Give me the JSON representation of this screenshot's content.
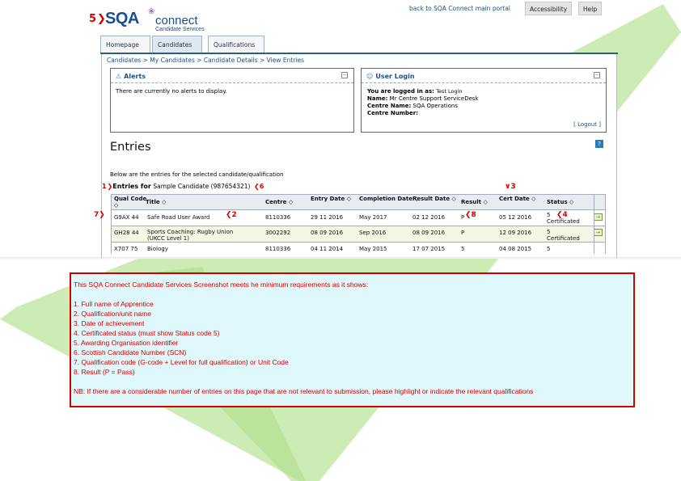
{
  "header": {
    "logo": {
      "brand": "SQA",
      "product": "connect",
      "subtitle": "Candidate Services"
    },
    "back_link": "back to SQA Connect main portal",
    "accessibility_label": "Accessibility",
    "help_label": "Help"
  },
  "tabs": [
    {
      "label": "Homepage"
    },
    {
      "label": "Candidates",
      "active": true
    },
    {
      "label": "Qualifications"
    }
  ],
  "breadcrumb": "Candidates > My Candidates > Candidate Details > View Entries",
  "alerts": {
    "title": "Alerts",
    "message": "There are currently no alerts to display."
  },
  "user_login": {
    "title": "User Login",
    "logged_in_label": "You are logged in as:",
    "logged_in_value": "Test Login",
    "name_label": "Name:",
    "name_value": "Mr Centre Support ServiceDesk",
    "centre_name_label": "Centre Name:",
    "centre_name_value": "SQA Operations",
    "centre_number_label": "Centre Number:",
    "logout_label": "[ Logout ]"
  },
  "entries": {
    "title": "Entries",
    "description": "Below are the entries for the selected candidate/qualification",
    "for_label": "Entries for",
    "candidate": "Sample Candidate (987654321)",
    "columns": [
      "Qual Code",
      "Title",
      "Centre",
      "Entry Date",
      "Completion Date",
      "Result Date",
      "Result",
      "Cert Date",
      "Status"
    ],
    "rows": [
      {
        "qual_code": "G9AX 44",
        "title": "Safe Road User Award",
        "title2": "",
        "centre": "8110336",
        "entry_date": "29 11 2016",
        "completion_date": "May 2017",
        "result_date": "02 12 2016",
        "result": "P",
        "cert_date": "05 12 2016",
        "status": "5",
        "status2": "Certificated"
      },
      {
        "qual_code": "GH28 44",
        "title": "Sports Coaching: Rugby Union",
        "title2": "(UKCC Level 1)",
        "centre": "3002292",
        "entry_date": "08 09 2016",
        "completion_date": "Sep 2016",
        "result_date": "08 09 2016",
        "result": "P",
        "cert_date": "12 09 2016",
        "status": "5",
        "status2": "Certificated"
      },
      {
        "qual_code": "X707 75",
        "title": "Biology",
        "title2": "",
        "centre": "8110336",
        "entry_date": "04 11 2014",
        "completion_date": "May 2015",
        "result_date": "17 07 2015",
        "result": "5",
        "cert_date": "04 08 2015",
        "status": "5",
        "status2": ""
      }
    ]
  },
  "annotations": {
    "n1": "1",
    "n2": "2",
    "n3": "3",
    "n4": "4",
    "n5": "5",
    "n6": "6",
    "n7": "7",
    "n8": "8"
  },
  "requirements": {
    "intro": "This SQA Connect Candidate Services Screenshot meets he minimum requirements as it shows:",
    "items": [
      "1. Full name of Apprentice",
      "2. Qualification/unit name",
      "3. Date of achievement",
      "4. Certificated status (must show Status code 5)",
      "5. Awarding Organisation identifier",
      "6. Scottish Candidate Number (SCN)",
      "7. Qualification code (G-code + Level for full qualification) or Unit Code",
      "8. Result (P = Pass)"
    ],
    "note": "NB:  If there are a considerable number of entries on this page that are not relevant to submission, please highlight or indicate the relevant qualifications"
  },
  "colors": {
    "annotation_red": "#d40000",
    "check_green": "#b9e398",
    "brand_blue": "#1c4f8a",
    "box_bg": "#dff8fb"
  }
}
